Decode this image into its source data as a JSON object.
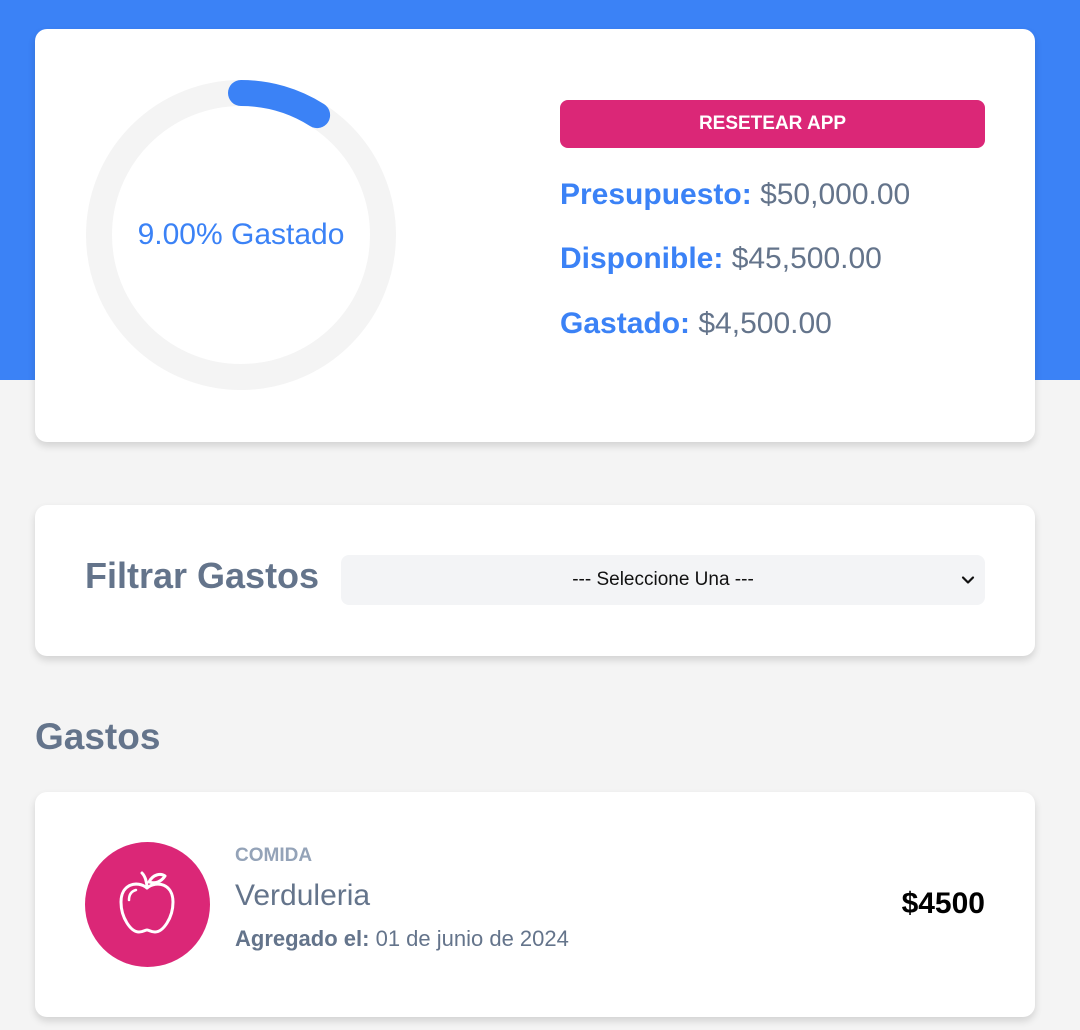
{
  "budget": {
    "percent_spent": 0.09,
    "percent_text": "9.00% Gastado",
    "reset_label": "RESETEAR APP",
    "presupuesto_label": "Presupuesto:",
    "presupuesto_value": "$50,000.00",
    "disponible_label": "Disponible:",
    "disponible_value": "$45,500.00",
    "gastado_label": "Gastado:",
    "gastado_value": "$4,500.00"
  },
  "filter": {
    "title": "Filtrar Gastos",
    "selected": "--- Seleccione Una ---"
  },
  "expenses": {
    "title": "Gastos",
    "items": [
      {
        "category": "COMIDA",
        "name": "Verduleria",
        "date_label": "Agregado el:",
        "date_value": "01 de junio de 2024",
        "amount": "$4500",
        "icon": "apple-icon"
      }
    ]
  },
  "colors": {
    "primary": "#3b82f6",
    "accent": "#db2777",
    "text_muted": "#64748b",
    "track": "#f4f4f4"
  }
}
